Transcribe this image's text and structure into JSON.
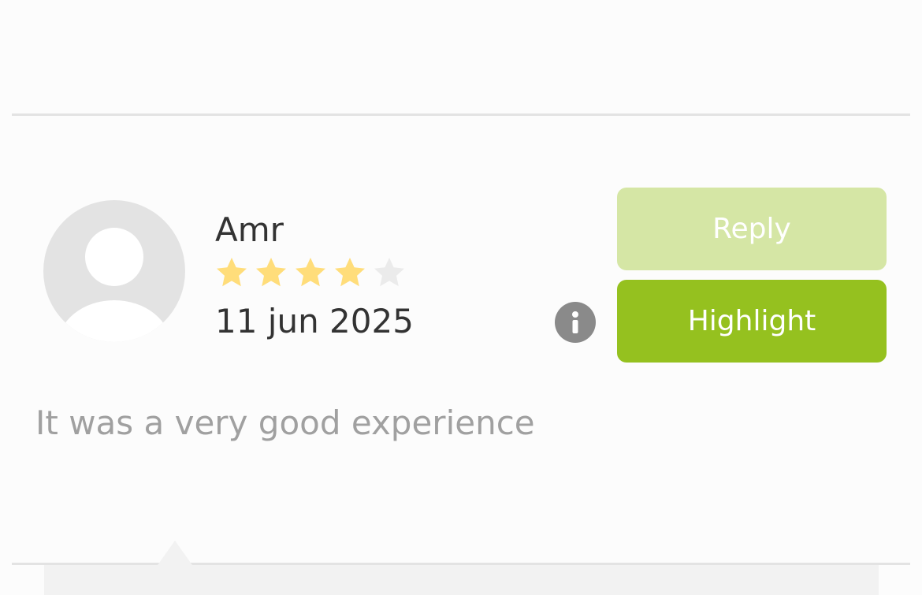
{
  "review": {
    "reviewer_name": "Amr",
    "rating": 4,
    "rating_max": 5,
    "date": "11 jun 2025",
    "text": "It was a very good experience",
    "avatar_icon": "default-user-avatar-icon"
  },
  "actions": {
    "reply_label": "Reply",
    "highlight_label": "Highlight",
    "info_icon": "info-icon"
  },
  "colors": {
    "star_filled": "#FFDD7A",
    "star_empty": "#EBEBEB",
    "reply_button": "#D5E6A5",
    "highlight_button": "#95C11F",
    "info_icon_bg": "#8A8A8A",
    "review_text": "#A0A0A0",
    "name_text": "#333333"
  }
}
